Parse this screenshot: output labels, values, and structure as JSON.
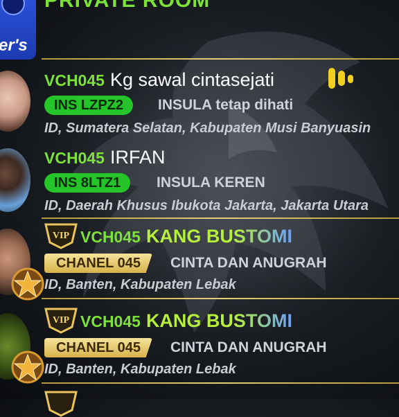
{
  "header": {
    "title": "PRIVATE ROOM",
    "badge_text": "er's"
  },
  "colors": {
    "green_code": "#7ce23a",
    "tag_green": "#25c42a",
    "gold": "#e0bf5a",
    "divider": "#d6bf6a"
  },
  "rows": [
    {
      "code": "VCH045",
      "name": "Kg sawal cintasejati",
      "tag": "INS  LZPZ2",
      "status": "INSULA tetap dihati",
      "location": "ID, Sumatera Selatan, Kabupaten Musi Banyuasin",
      "icon": "audio-bars-icon"
    },
    {
      "code": "VCH045",
      "name": "IRFAN",
      "tag": "INS  8LTZ1",
      "status": "INSULA KEREN",
      "location": "ID, Daerah Khusus Ibukota Jakarta, Jakarta Utara"
    },
    {
      "code": "VCH045",
      "name": "KANG BUSTOMI",
      "tag": "CHANEL 045",
      "status": "CINTA DAN ANUGRAH",
      "location": "ID, Banten, Kabupaten Lebak",
      "vip": true
    },
    {
      "code": "VCH045",
      "name": "KANG BUSTOMI",
      "tag": "CHANEL 045",
      "status": "CINTA DAN ANUGRAH",
      "location": "ID, Banten, Kabupaten Lebak",
      "vip": true
    }
  ]
}
